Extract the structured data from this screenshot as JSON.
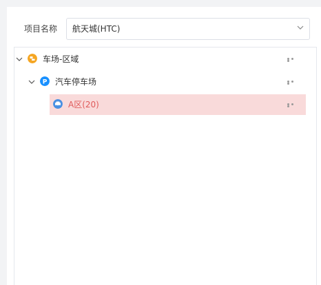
{
  "form": {
    "project_label": "项目名称",
    "project_value": "航天城(HTC)"
  },
  "tree": [
    {
      "label": "车场-区域",
      "level": 0,
      "expanded": true,
      "icon": "parking-area-icon",
      "icon_color": "#f5a623",
      "selected": false
    },
    {
      "label": "汽车停车场",
      "level": 1,
      "expanded": true,
      "icon": "parking-p-icon",
      "icon_color": "#1890ff",
      "selected": false
    },
    {
      "label": "A区(20)",
      "level": 2,
      "expanded": false,
      "icon": "car-icon",
      "icon_color": "#4a90e2",
      "selected": true
    }
  ],
  "colors": {
    "selected_bg": "#f9dada",
    "selected_text": "#e05a5a"
  }
}
